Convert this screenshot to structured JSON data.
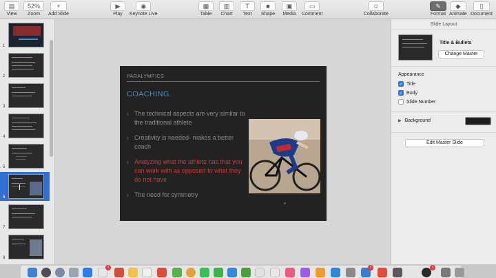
{
  "toolbar": {
    "left": [
      {
        "label": "View",
        "icon": "view-icon"
      },
      {
        "label": "Zoom",
        "value": "52%"
      },
      {
        "label": "Add Slide",
        "icon": "plus-icon"
      }
    ],
    "play": {
      "label": "Play"
    },
    "keynote_live": {
      "label": "Keynote Live"
    },
    "insert": [
      {
        "label": "Table"
      },
      {
        "label": "Chart"
      },
      {
        "label": "Text"
      },
      {
        "label": "Shape"
      },
      {
        "label": "Media"
      },
      {
        "label": "Comment"
      }
    ],
    "collaborate": {
      "label": "Collaborate"
    },
    "right": [
      {
        "label": "Format"
      },
      {
        "label": "Animate"
      },
      {
        "label": "Document"
      }
    ]
  },
  "navigator": {
    "slides": [
      {
        "number": "1"
      },
      {
        "number": "2"
      },
      {
        "number": "3"
      },
      {
        "number": "4"
      },
      {
        "number": "5"
      },
      {
        "number": "6"
      },
      {
        "number": "7"
      },
      {
        "number": "8"
      }
    ],
    "selected_index": 5
  },
  "slide": {
    "kicker": "PARALYMPICS",
    "title": "COACHING",
    "bullets": [
      {
        "text": "The technical aspects are very similar to the traditional athlete",
        "highlight": false
      },
      {
        "text": "Creativity is needed- makes a better coach",
        "highlight": false
      },
      {
        "text": "Analyzing what the athlete has that you can work with as opposed to what they do not have",
        "highlight": true
      },
      {
        "text": "The need for symmetry",
        "highlight": false
      }
    ],
    "accent_color": "#4a90c8",
    "highlight_color": "#d63a32"
  },
  "inspector": {
    "header": "Slide Layout",
    "layout_name": "Title & Bullets",
    "change_master": "Change Master",
    "appearance_title": "Appearance",
    "options": [
      {
        "label": "Title",
        "checked": true
      },
      {
        "label": "Body",
        "checked": true
      },
      {
        "label": "Slide Number",
        "checked": false
      }
    ],
    "background_label": "Background",
    "background_color": "#1e1e1e",
    "edit_master": "Edit Master Slide"
  },
  "dock": {
    "badges": [
      "1",
      "2",
      "1"
    ]
  }
}
